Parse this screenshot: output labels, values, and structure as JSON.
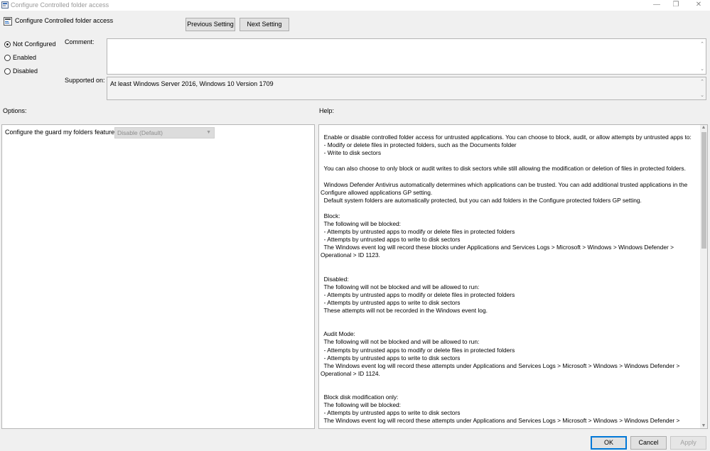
{
  "window": {
    "title": "Configure Controlled folder access",
    "controls": {
      "minimize_icon": "minimize-icon",
      "maximize_icon": "maximize-icon",
      "close_icon": "close-icon"
    }
  },
  "header": {
    "policy_title": "Configure Controlled folder access",
    "previous_label": "Previous Setting",
    "next_label": "Next Setting"
  },
  "state": {
    "options": [
      {
        "label": "Not Configured",
        "checked": true
      },
      {
        "label": "Enabled",
        "checked": false
      },
      {
        "label": "Disabled",
        "checked": false
      }
    ]
  },
  "comment": {
    "label": "Comment:",
    "value": ""
  },
  "supported": {
    "label": "Supported on:",
    "value": "At least Windows Server 2016, Windows 10 Version 1709"
  },
  "options_section": {
    "label": "Options:",
    "feature_label": "Configure the guard my folders feature",
    "feature_value": "Disable (Default)"
  },
  "help": {
    "label": "Help:",
    "lines": [
      "  Enable or disable controlled folder access for untrusted applications. You can choose to block, audit, or allow attempts by untrusted apps to:",
      "  - Modify or delete files in protected folders, such as the Documents folder",
      "  - Write to disk sectors",
      "",
      "  You can also choose to only block or audit writes to disk sectors while still allowing the modification or deletion of files in protected folders.",
      "",
      "  Windows Defender Antivirus automatically determines which applications can be trusted. You can add additional trusted applications in the",
      "Configure allowed applications GP setting.",
      "  Default system folders are automatically protected, but you can add folders in the Configure protected folders GP setting.",
      "",
      "  Block:",
      "  The following will be blocked:",
      "  - Attempts by untrusted apps to modify or delete files in protected folders",
      "  - Attempts by untrusted apps to write to disk sectors",
      "  The Windows event log will record these blocks under Applications and Services Logs > Microsoft > Windows > Windows Defender >",
      "Operational > ID 1123.",
      "",
      "",
      "  Disabled:",
      "  The following will not be blocked and will be allowed to run:",
      "  - Attempts by untrusted apps to modify or delete files in protected folders",
      "  - Attempts by untrusted apps to write to disk sectors",
      "  These attempts will not be recorded in the Windows event log.",
      "",
      "",
      "  Audit Mode:",
      "  The following will not be blocked and will be allowed to run:",
      "  - Attempts by untrusted apps to modify or delete files in protected folders",
      "  - Attempts by untrusted apps to write to disk sectors",
      "  The Windows event log will record these attempts under Applications and Services Logs > Microsoft > Windows > Windows Defender >",
      "Operational > ID 1124.",
      "",
      "",
      "  Block disk modification only:",
      "  The following will be blocked:",
      "  - Attempts by untrusted apps to write to disk sectors",
      "  The Windows event log will record these attempts under Applications and Services Logs > Microsoft > Windows > Windows Defender >"
    ]
  },
  "footer": {
    "ok_label": "OK",
    "cancel_label": "Cancel",
    "apply_label": "Apply"
  },
  "colors": {
    "accent": "#0078d7",
    "window_bg": "#f0f0f0",
    "field_bg": "#ffffff"
  }
}
